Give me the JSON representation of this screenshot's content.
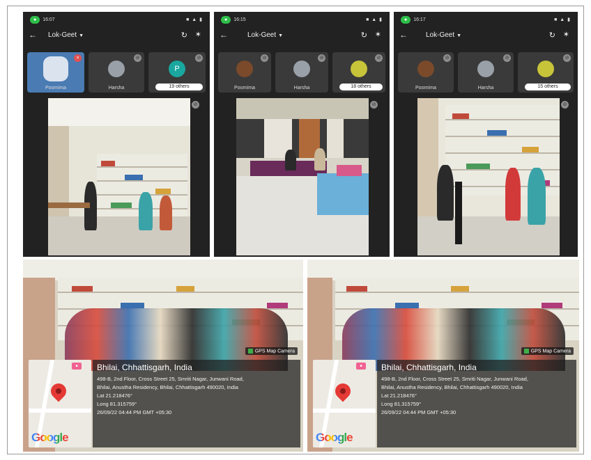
{
  "phones": [
    {
      "status_time": "16:07",
      "meeting_title": "Lok-Geet",
      "participants": [
        {
          "name": "Poornima"
        },
        {
          "name": "Harsha"
        },
        {
          "initial": "P",
          "others": "19 others"
        }
      ]
    },
    {
      "status_time": "16:15",
      "meeting_title": "Lok-Geet",
      "participants": [
        {
          "name": "Poornima"
        },
        {
          "name": "Harsha"
        },
        {
          "others": "18 others"
        }
      ]
    },
    {
      "status_time": "16:17",
      "meeting_title": "Lok-Geet",
      "participants": [
        {
          "name": "Poornima"
        },
        {
          "name": "Harsha"
        },
        {
          "others": "15 others"
        }
      ]
    }
  ],
  "gps_photos": [
    {
      "camera_label": "GPS Map Camera",
      "place": "Bhilai, Chhattisgarh, India",
      "address_line1": "498-B, 2nd Floor, Cross Street 25, Smriti Nagar, Junwani Road,",
      "address_line2": "Bhilai, Anustha Residency, Bhilai, Chhattisgarh 490020, India",
      "lat": "Lat 21.218476°",
      "long": "Long 81.315759°",
      "datetime": "26/09/22 04:44 PM GMT +05:30",
      "logo": "Google"
    },
    {
      "camera_label": "GPS Map Camera",
      "place": "Bhilai, Chhattisgarh, India",
      "address_line1": "498-B, 2nd Floor, Cross Street 25, Smriti Nagar, Junwani Road,",
      "address_line2": "Bhilai, Anustha Residency, Bhilai, Chhattisgarh 490020, India",
      "lat": "Lat 21.218476°",
      "long": "Long 81.315759°",
      "datetime": "26/09/22 04:44 PM GMT +05:30",
      "logo": "Google"
    }
  ],
  "icons": {
    "back": "arrow-left-icon",
    "camera_switch": "camera-switch-icon",
    "bluetooth": "bluetooth-icon",
    "mic_off": "mic-off-icon",
    "map_pin": "map-pin-icon"
  },
  "colors": {
    "status_pill": "#2fbf4a",
    "pin": "#e53935",
    "phone_bg": "#222222"
  }
}
